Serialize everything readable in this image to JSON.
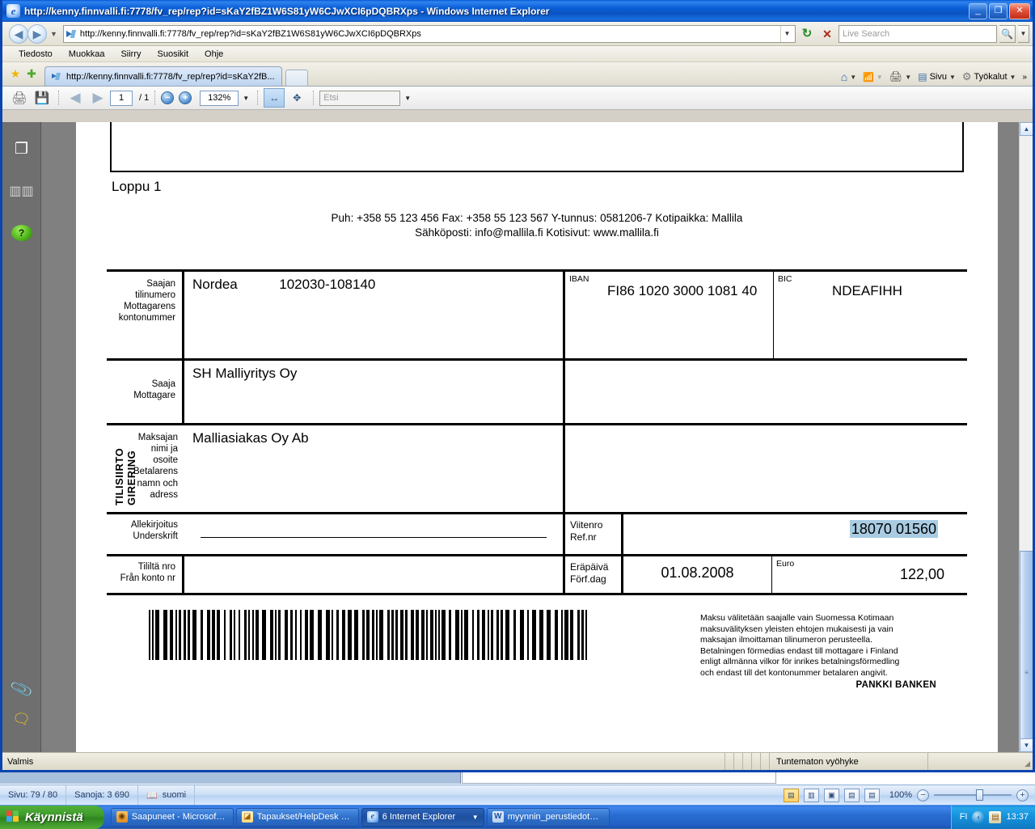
{
  "window": {
    "title": "http://kenny.finnvalli.fi:7778/fv_rep/rep?id=sKaY2fBZ1W6S81yW6CJwXCI6pDQBRXps - Windows Internet Explorer",
    "minimize_label": "_",
    "maximize_label": "❐",
    "close_label": "✕"
  },
  "address_bar": {
    "url": "http://kenny.finnvalli.fi:7778/fv_rep/rep?id=sKaY2fBZ1W6S81yW6CJwXCI6pDQBRXps",
    "back_label": "◀",
    "forward_label": "▶",
    "history_caret": "▼",
    "dropdown_caret": "▼",
    "refresh_label": "↻",
    "stop_label": "✕",
    "search_placeholder": "Live Search",
    "search_go_label": "🔍",
    "search_caret": "▼"
  },
  "menu": {
    "items": [
      "Tiedosto",
      "Muokkaa",
      "Siirry",
      "Suosikit",
      "Ohje"
    ]
  },
  "tabs": {
    "favorites_star": "★",
    "add_favorite": "✚",
    "items": [
      {
        "label": "http://kenny.finnvalli.fi:7778/fv_rep/rep?id=sKaY2fB..."
      }
    ],
    "new_tab_label": "",
    "right_tools": {
      "home": "⌂",
      "home_caret": "▼",
      "feeds": "📶",
      "feeds_caret": "▼",
      "print": "🖨",
      "print_caret": "▼",
      "page_label": "Sivu",
      "page_caret": "▼",
      "tools_label": "Työkalut",
      "tools_caret": "▼",
      "overflow": "»"
    }
  },
  "viewer_toolbar": {
    "print_label": "🖨",
    "save_label": "💾",
    "prev_page_label": "◀",
    "next_page_label": "▶",
    "current_page": "1",
    "page_count": "/ 1",
    "zoom_out_label": "−",
    "zoom_in_label": "+",
    "zoom_level": "132%",
    "zoom_caret": "▼",
    "fit_width_label": "↔",
    "fit_page_label": "✥",
    "find_placeholder": "Etsi",
    "find_caret": "▼"
  },
  "side_panel": {
    "items": [
      {
        "name": "pages-icon",
        "glyph": "❐"
      },
      {
        "name": "thumbnails-icon",
        "glyph": "▥▥"
      },
      {
        "name": "help-icon",
        "glyph": "?"
      }
    ],
    "bottom_items": [
      {
        "name": "attachments-icon",
        "glyph": "📎"
      },
      {
        "name": "comments-icon",
        "glyph": "🗨"
      }
    ]
  },
  "document": {
    "section_label": "Loppu 1",
    "contact_line_1": "Puh: +358 55 123 456 Fax: +358 55 123 567 Y-tunnus: 0581206-7 Kotipaikka: Mallila",
    "contact_line_2": "Sähköposti: info@mallila.fi Kotisivut: www.mallila.fi",
    "giro": {
      "vertical_label": "TILISIIRTO GIRERING",
      "receiver_account": {
        "label_fi_1": "Saajan",
        "label_fi_2": "tilinumero",
        "label_sv_1": "Mottagarens",
        "label_sv_2": "kontonummer",
        "bank_name": "Nordea",
        "account_number": "102030-108140"
      },
      "iban": {
        "label": "IBAN",
        "value": "FI86 1020 3000 1081 40"
      },
      "bic": {
        "label": "BIC",
        "value": "NDEAFIHH"
      },
      "receiver": {
        "label_fi": "Saaja",
        "label_sv": "Mottagare",
        "value": "SH Malliyritys Oy"
      },
      "payer": {
        "label_fi_1": "Maksajan",
        "label_fi_2": "nimi ja",
        "label_fi_3": "osoite",
        "label_sv_1": "Betalarens",
        "label_sv_2": "namn och",
        "label_sv_3": "adress",
        "value": "Malliasiakas Oy Ab"
      },
      "signature": {
        "label_fi": "Allekirjoitus",
        "label_sv": "Underskrift"
      },
      "from_account": {
        "label_fi": "Tililtä nro",
        "label_sv": "Från konto nr"
      },
      "reference": {
        "label_fi": "Viitenro",
        "label_sv": "Ref.nr",
        "value": "18070 01560",
        "highlight_color": "#a9cce3"
      },
      "due_date": {
        "label_fi": "Eräpäivä",
        "label_sv": "Förf.dag",
        "value": "01.08.2008"
      },
      "amount": {
        "label": "Euro",
        "value": "122,00"
      },
      "legal_lines": [
        "Maksu välitetään saajalle vain Suomessa Kotimaan",
        "maksuvälityksen yleisten ehtojen mukaisesti ja vain",
        "maksajan ilmoittaman tilinumeron perusteella.",
        "Betalningen förmedias endast till mottagare i Finland",
        "enligt allmänna vilkor för inrikes betalningsförmedling",
        "och endast till det kontonummer betalaren angivit."
      ],
      "legal_bank": "PANKKI BANKEN"
    }
  },
  "scrollbar": {
    "up_label": "▲",
    "down_label": "▼",
    "thumb_grip": "≡"
  },
  "status_bar": {
    "text": "Valmis",
    "zone": "Tuntematon vyöhyke",
    "grip": "◢"
  },
  "word_status_bar": {
    "page": "Sivu: 79 / 80",
    "words": "Sanoja: 3 690",
    "proof_icon": "📖",
    "language": "suomi",
    "view_buttons": [
      {
        "name": "print-layout-view",
        "glyph": "▤",
        "active": true
      },
      {
        "name": "full-screen-reading-view",
        "glyph": "▥",
        "active": false
      },
      {
        "name": "web-layout-view",
        "glyph": "▣",
        "active": false
      },
      {
        "name": "outline-view",
        "glyph": "▤",
        "active": false
      },
      {
        "name": "draft-view",
        "glyph": "▤",
        "active": false
      }
    ],
    "zoom_out": "−",
    "zoom_in": "+",
    "zoom_value": "100%"
  },
  "taskbar": {
    "start_label": "Käynnistä",
    "items": [
      {
        "label": "Saapuneet - Microsof…",
        "icon": "outlook",
        "glyph": "◉",
        "active": false
      },
      {
        "label": "Tapaukset/HelpDesk …",
        "icon": "page",
        "glyph": "◪",
        "active": false
      },
      {
        "label": "6 Internet Explorer",
        "icon": "ie",
        "glyph": "e",
        "active": true,
        "caret": "▼"
      },
      {
        "label": "myynnin_perustiedot…",
        "icon": "word",
        "glyph": "W",
        "active": false
      }
    ],
    "tray": {
      "language": "FI",
      "chevron": "‹",
      "icon": "▤",
      "clock": "13:37"
    }
  }
}
